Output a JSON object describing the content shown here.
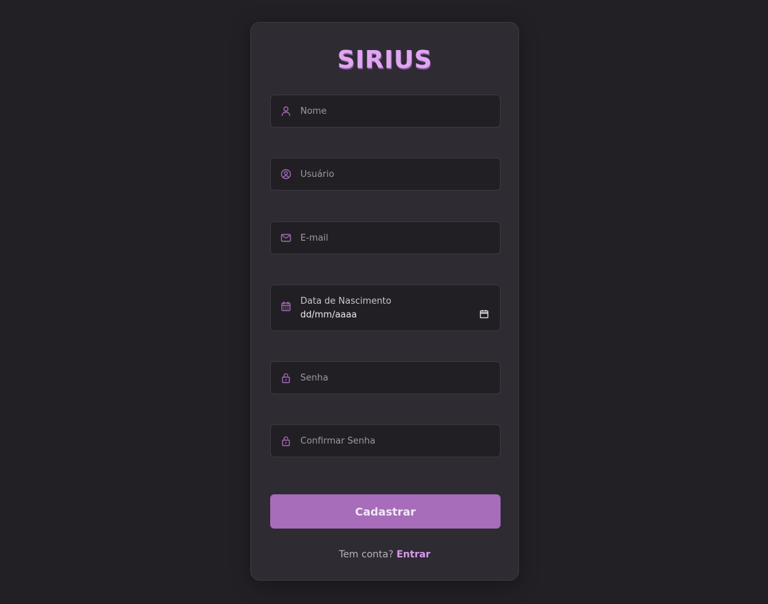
{
  "brand": {
    "title": "SIRIUS",
    "accent_color": "#a76cba",
    "title_color": "#e0a6f0"
  },
  "form": {
    "fields": [
      {
        "placeholder": "Nome",
        "icon": "user-icon"
      },
      {
        "placeholder": "Usuário",
        "icon": "user-circle-icon"
      },
      {
        "placeholder": "E-mail",
        "icon": "mail-icon"
      },
      {
        "label": "Data de Nascimento",
        "value": "dd/mm/aaaa",
        "icon": "calendar-icon"
      },
      {
        "placeholder": "Senha",
        "icon": "lock-icon"
      },
      {
        "placeholder": "Confirmar Senha",
        "icon": "lock-icon"
      }
    ],
    "submit_label": "Cadastrar"
  },
  "footer": {
    "text": "Tem conta?",
    "link_label": "Entrar"
  }
}
